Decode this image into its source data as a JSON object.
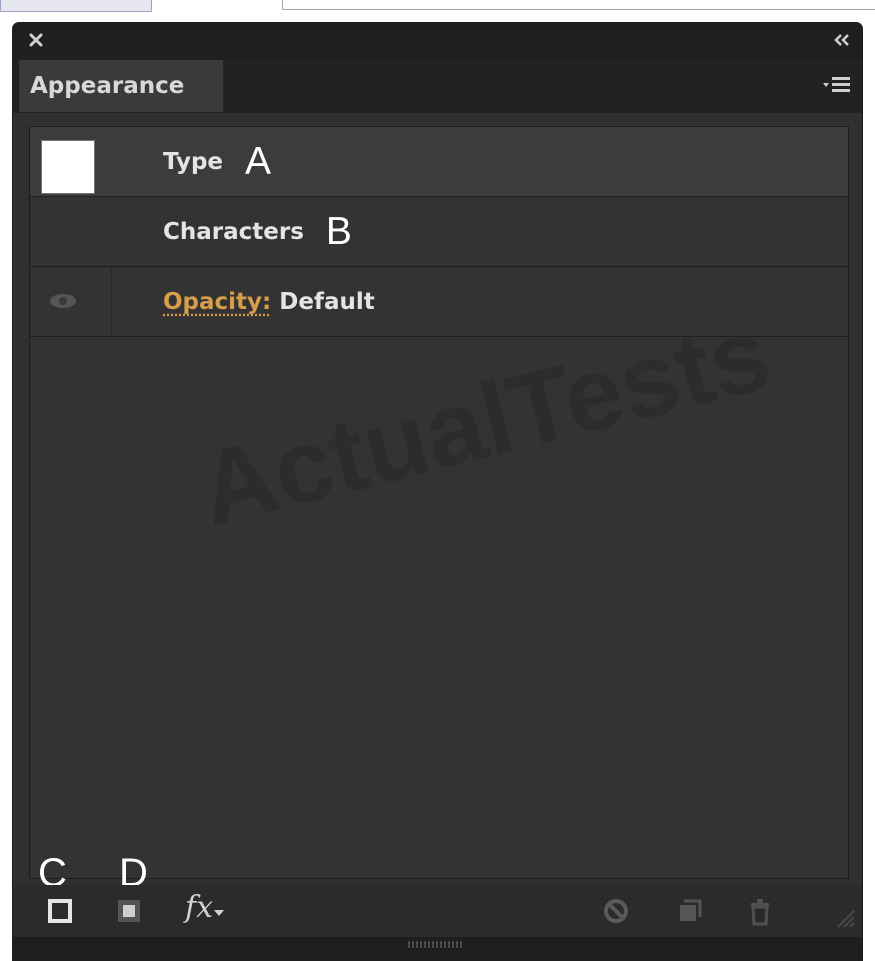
{
  "panel": {
    "tab_label": "Appearance",
    "rows": [
      {
        "label": "Type",
        "callout": "A"
      },
      {
        "label": "Characters",
        "callout": "B"
      },
      {
        "link": "Opacity:",
        "value": "Default"
      }
    ],
    "watermark": "ActualTests",
    "callouts": {
      "c": "C",
      "d": "D"
    },
    "footer": {
      "fx_label": "fx"
    }
  },
  "icons": {
    "titlebar": [
      "close-icon",
      "collapse-panel-icon"
    ],
    "tabbar": [
      "panel-menu-icon"
    ],
    "footer": [
      "add-new-stroke-icon",
      "add-new-fill-icon",
      "add-effect-icon",
      "clear-appearance-icon",
      "duplicate-item-icon",
      "delete-item-icon"
    ]
  },
  "colors": {
    "panel_bg": "#303030",
    "opacity_link": "#d89d4a",
    "swatch_fill": "#ffffff"
  }
}
